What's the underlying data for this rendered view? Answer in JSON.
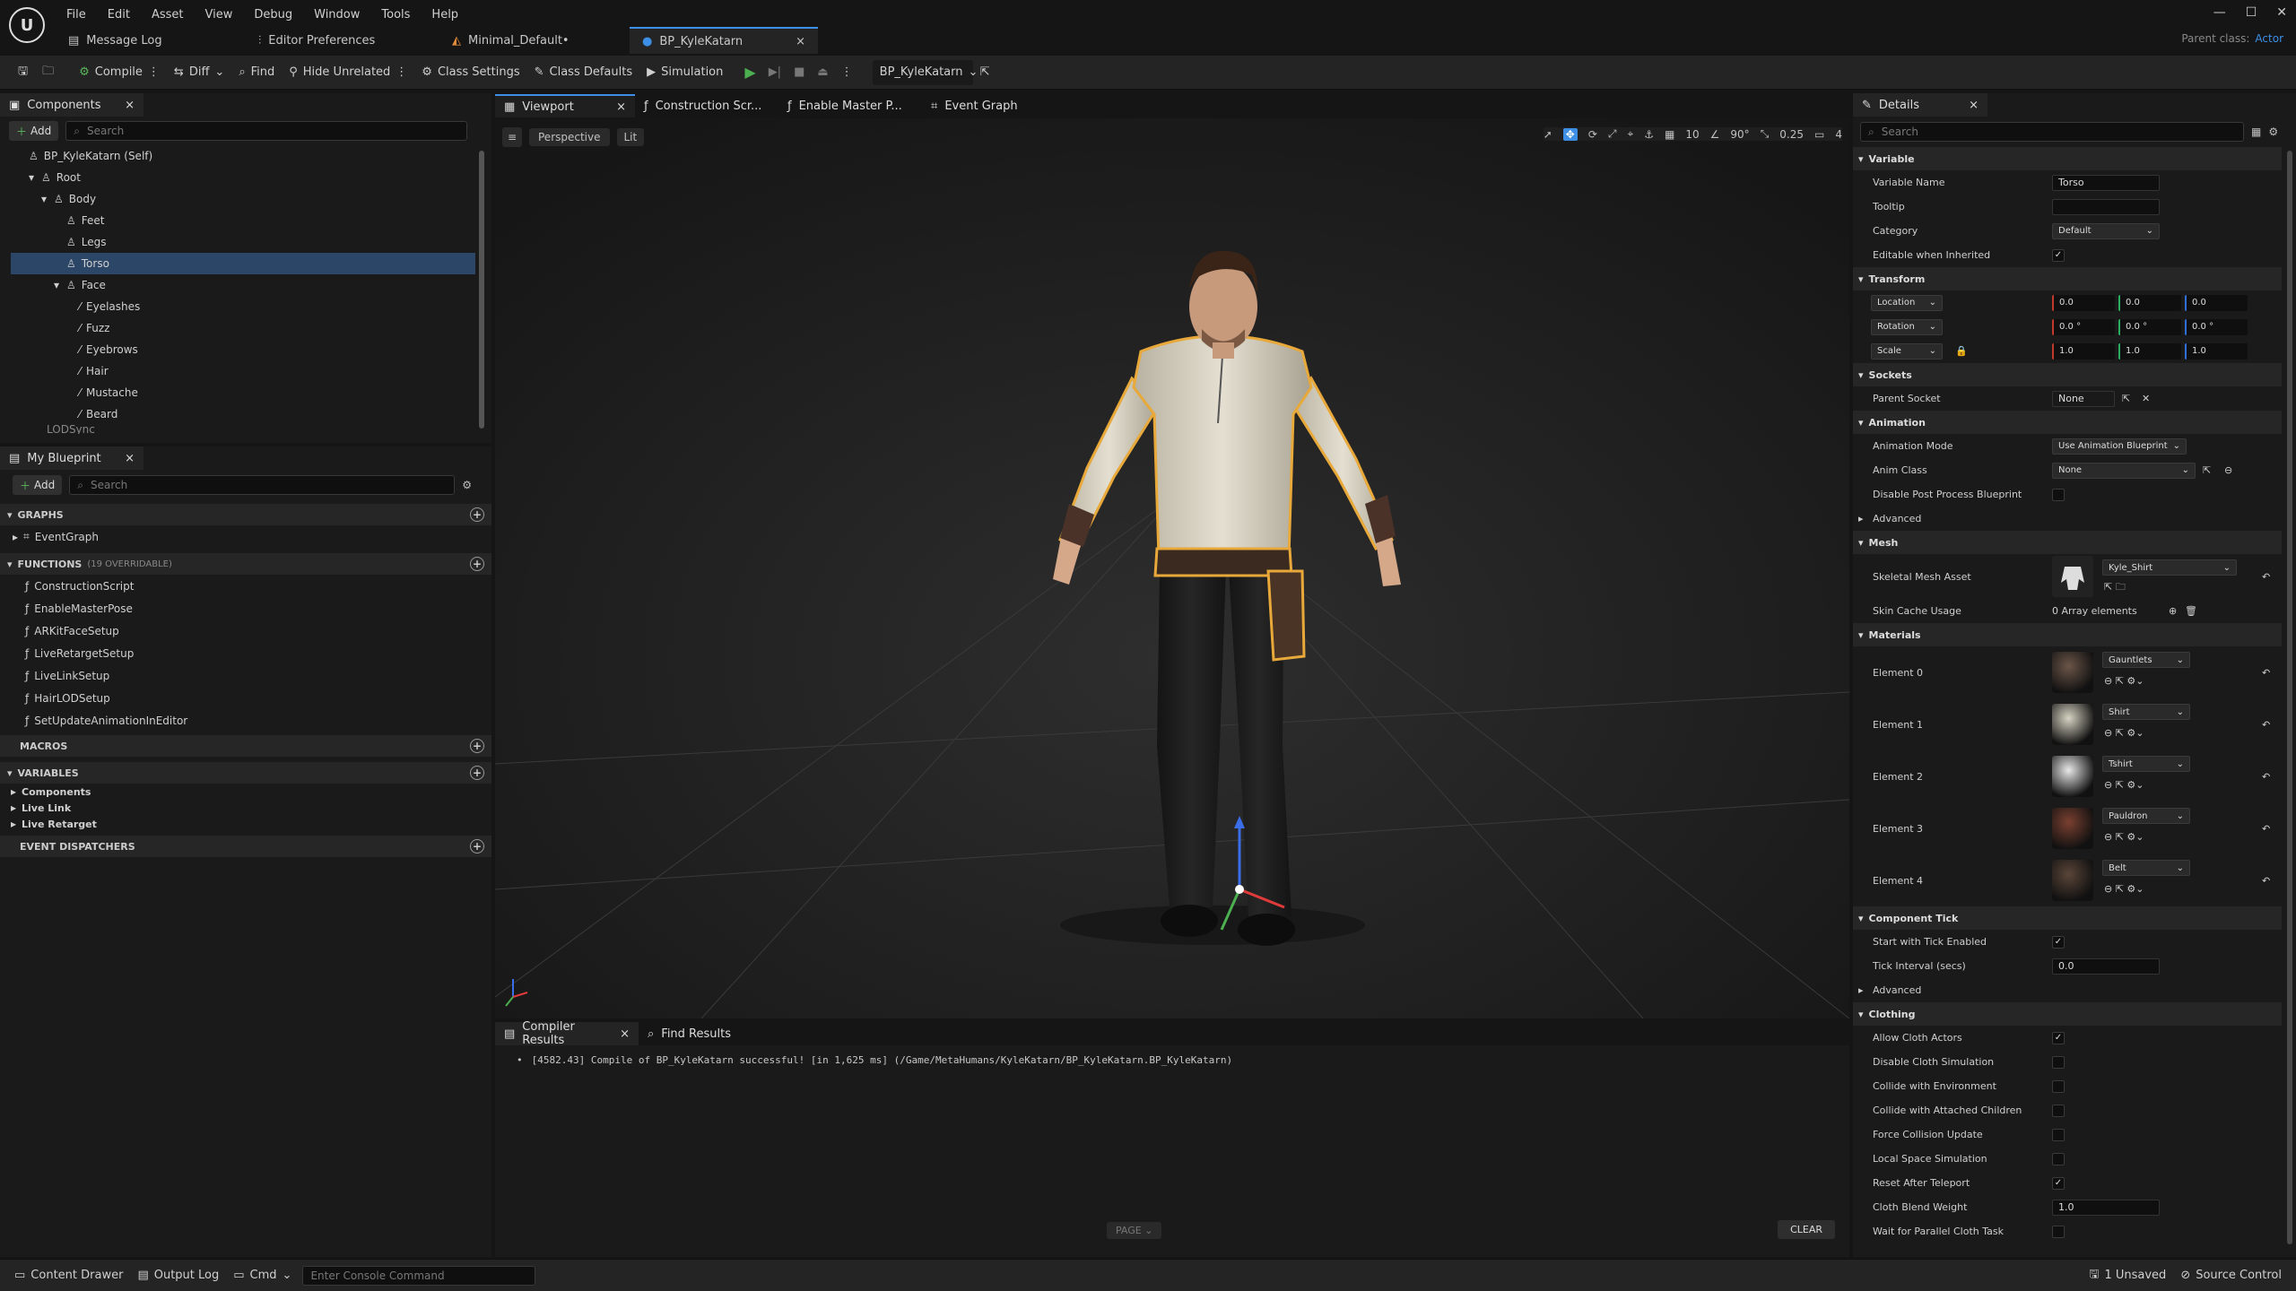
{
  "app": {
    "logo": "unreal-logo"
  },
  "menu": [
    "File",
    "Edit",
    "Asset",
    "View",
    "Debug",
    "Window",
    "Tools",
    "Help"
  ],
  "doc_tabs": [
    {
      "label": "Message Log",
      "icon": "message-log-icon"
    },
    {
      "label": "Editor Preferences",
      "icon": "preferences-icon"
    },
    {
      "label": "Minimal_Default•",
      "icon": "level-icon"
    },
    {
      "label": "BP_KyleKatarn",
      "icon": "blueprint-icon",
      "close": "×"
    }
  ],
  "parent_class": "Parent class:",
  "parent_class_value": "Actor",
  "toolbar": {
    "compile": "Compile",
    "diff": "Diff",
    "find": "Find",
    "hide_unrelated": "Hide Unrelated",
    "class_settings": "Class Settings",
    "class_defaults": "Class Defaults",
    "simulation": "Simulation",
    "debug_object": "BP_KyleKatarn"
  },
  "components": {
    "tab": "Components",
    "add": "Add",
    "search_placeholder": "Search",
    "items": [
      {
        "label": "BP_KyleKatarn (Self)",
        "indent": 0
      },
      {
        "label": "Root",
        "indent": 1
      },
      {
        "label": "Body",
        "indent": 2
      },
      {
        "label": "Feet",
        "indent": 3
      },
      {
        "label": "Legs",
        "indent": 3
      },
      {
        "label": "Torso",
        "indent": 3,
        "selected": true
      },
      {
        "label": "Face",
        "indent": 3
      },
      {
        "label": "Eyelashes",
        "indent": 4
      },
      {
        "label": "Fuzz",
        "indent": 4
      },
      {
        "label": "Eyebrows",
        "indent": 4
      },
      {
        "label": "Hair",
        "indent": 4
      },
      {
        "label": "Mustache",
        "indent": 4
      },
      {
        "label": "Beard",
        "indent": 4
      }
    ],
    "partial": "LODSync"
  },
  "my_blueprint": {
    "tab": "My Blueprint",
    "add": "Add",
    "search_placeholder": "Search",
    "graphs": "GRAPHS",
    "event_graph": "EventGraph",
    "functions": "FUNCTIONS",
    "functions_note": "(19 OVERRIDABLE)",
    "function_list": [
      "ConstructionScript",
      "EnableMasterPose",
      "ARKitFaceSetup",
      "LiveRetargetSetup",
      "LiveLinkSetup",
      "HairLODSetup",
      "SetUpdateAnimationInEditor"
    ],
    "macros": "MACROS",
    "variables": "VARIABLES",
    "variable_groups": [
      "Components",
      "Live Link",
      "Live Retarget"
    ],
    "event_dispatchers": "EVENT DISPATCHERS"
  },
  "editor_tabs": [
    {
      "label": "Viewport",
      "icon": "viewport-icon"
    },
    {
      "label": "Construction Scr...",
      "icon": "function-icon"
    },
    {
      "label": "Enable Master P...",
      "icon": "function-icon"
    },
    {
      "label": "Event Graph",
      "icon": "graph-icon"
    }
  ],
  "viewport": {
    "perspective": "Perspective",
    "lit": "Lit",
    "grid_snap": "10",
    "rot_snap": "90°",
    "scale_snap": "0.25",
    "cam_speed": "4"
  },
  "compiler": {
    "tab": "Compiler Results",
    "find_tab": "Find Results",
    "message": "[4582.43] Compile of BP_KyleKatarn successful! [in 1,625 ms] (/Game/MetaHumans/KyleKatarn/BP_KyleKatarn.BP_KyleKatarn)",
    "page": "PAGE",
    "clear": "CLEAR"
  },
  "details": {
    "tab": "Details",
    "search_placeholder": "Search",
    "variable": {
      "section": "Variable",
      "name_label": "Variable Name",
      "name_value": "Torso",
      "tooltip_label": "Tooltip",
      "category_label": "Category",
      "category_value": "Default",
      "editable_label": "Editable when Inherited"
    },
    "transform": {
      "section": "Transform",
      "location": "Location",
      "rotation": "Rotation",
      "scale": "Scale",
      "loc": [
        "0.0",
        "0.0",
        "0.0"
      ],
      "rot": [
        "0.0 °",
        "0.0 °",
        "0.0 °"
      ],
      "scl": [
        "1.0",
        "1.0",
        "1.0"
      ]
    },
    "sockets": {
      "section": "Sockets",
      "parent_socket": "Parent Socket",
      "value": "None"
    },
    "animation": {
      "section": "Animation",
      "mode_label": "Animation Mode",
      "mode_value": "Use Animation Blueprint",
      "class_label": "Anim Class",
      "class_value": "None",
      "disable_pp": "Disable Post Process Blueprint",
      "advanced": "Advanced"
    },
    "mesh": {
      "section": "Mesh",
      "asset_label": "Skeletal Mesh Asset",
      "asset_value": "Kyle_Shirt",
      "skin_label": "Skin Cache Usage",
      "skin_value": "0 Array elements"
    },
    "materials": {
      "section": "Materials",
      "elements": [
        {
          "label": "Element 0",
          "value": "Gauntlets",
          "color": "#6b5548"
        },
        {
          "label": "Element 1",
          "value": "Shirt",
          "color": "#d8d4c4"
        },
        {
          "label": "Element 2",
          "value": "Tshirt",
          "color": "#e8e8e8"
        },
        {
          "label": "Element 3",
          "value": "Pauldron",
          "color": "#7a4030"
        },
        {
          "label": "Element 4",
          "value": "Belt",
          "color": "#5a4538"
        }
      ]
    },
    "tick": {
      "section": "Component Tick",
      "start_label": "Start with Tick Enabled",
      "interval_label": "Tick Interval (secs)",
      "interval_value": "0.0",
      "advanced": "Advanced"
    },
    "clothing": {
      "section": "Clothing",
      "rows": [
        {
          "label": "Allow Cloth Actors",
          "checked": true
        },
        {
          "label": "Disable Cloth Simulation",
          "checked": false
        },
        {
          "label": "Collide with Environment",
          "checked": false
        },
        {
          "label": "Collide with Attached Children",
          "checked": false
        },
        {
          "label": "Force Collision Update",
          "checked": false
        },
        {
          "label": "Local Space Simulation",
          "checked": false
        },
        {
          "label": "Reset After Teleport",
          "checked": true
        }
      ],
      "blend_label": "Cloth Blend Weight",
      "blend_value": "1.0",
      "parallel_label": "Wait for Parallel Cloth Task"
    }
  },
  "status": {
    "content_drawer": "Content Drawer",
    "output_log": "Output Log",
    "cmd": "Cmd",
    "console_placeholder": "Enter Console Command",
    "unsaved": "1 Unsaved",
    "source_control": "Source Control"
  },
  "colors": {
    "accent": "#3d8fe6",
    "selection": "#2c4667",
    "outline": "#e8a93a",
    "play": "#4caf50"
  }
}
